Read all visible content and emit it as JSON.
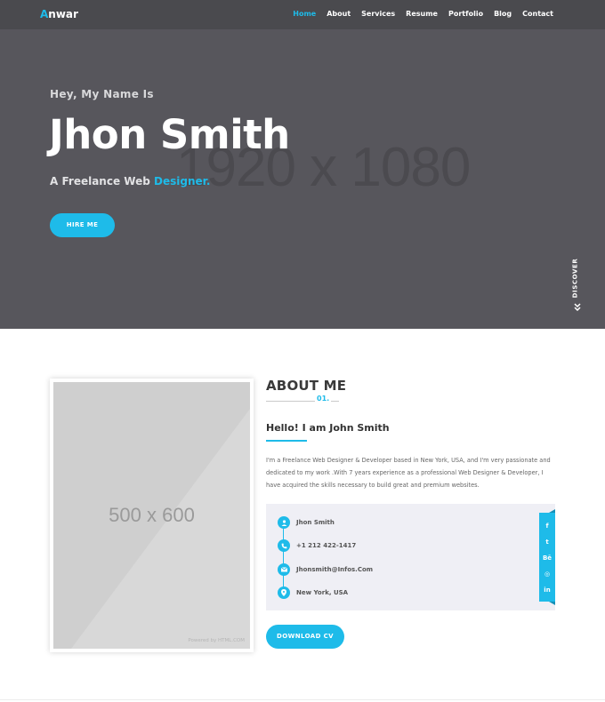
{
  "nav": {
    "logo_first": "A",
    "logo_rest": "nwar",
    "items": [
      {
        "label": "Home",
        "active": true
      },
      {
        "label": "About"
      },
      {
        "label": "Services"
      },
      {
        "label": "Resume"
      },
      {
        "label": "Portfolio"
      },
      {
        "label": "Blog"
      },
      {
        "label": "Contact"
      }
    ]
  },
  "hero": {
    "greeting": "Hey, My Name Is",
    "name": "Jhon Smith",
    "subtitle_prefix": "A Freelance Web ",
    "subtitle_highlight": "Designer",
    "subtitle_suffix": ".",
    "placeholder_text": "1920 x 1080",
    "hire_button": "HIRE ME",
    "discover": "DISCOVER",
    "discover_icon": "double-chevron-down-icon"
  },
  "about": {
    "photo_placeholder": "500 x 600",
    "photo_powered": "Powered by HTML.COM",
    "title": "ABOUT ME",
    "number": "01.",
    "hello": "Hello! I am John Smith",
    "bio": "I'm a Freelance Web Designer & Developer based in New York, USA, and I'm very passionate and dedicated to my work .With 7 years experience as a professional Web Designer & Developer, I have acquired the skills necessary to build great and premium websites.",
    "info": [
      {
        "icon": "user-icon",
        "glyph": "👤",
        "text": "Jhon Smith"
      },
      {
        "icon": "phone-icon",
        "glyph": "✆",
        "text": "+1 212 422-1417"
      },
      {
        "icon": "envelope-icon",
        "glyph": "✉",
        "text": "Jhonsmith@Infos.Com"
      },
      {
        "icon": "map-pin-icon",
        "glyph": "●",
        "text": "New York, USA"
      }
    ],
    "social": [
      {
        "icon": "facebook-icon",
        "glyph": "f"
      },
      {
        "icon": "twitter-icon",
        "glyph": "t"
      },
      {
        "icon": "behance-icon",
        "glyph": "Bē"
      },
      {
        "icon": "dribbble-icon",
        "glyph": "◎"
      },
      {
        "icon": "linkedin-icon",
        "glyph": "in"
      }
    ],
    "download_button": "DOWNLOAD CV"
  },
  "colors": {
    "accent": "#1ebbe9",
    "hero_bg": "#57565c",
    "nav_bg": "#4a4a4e",
    "info_bg": "#efeff5"
  }
}
